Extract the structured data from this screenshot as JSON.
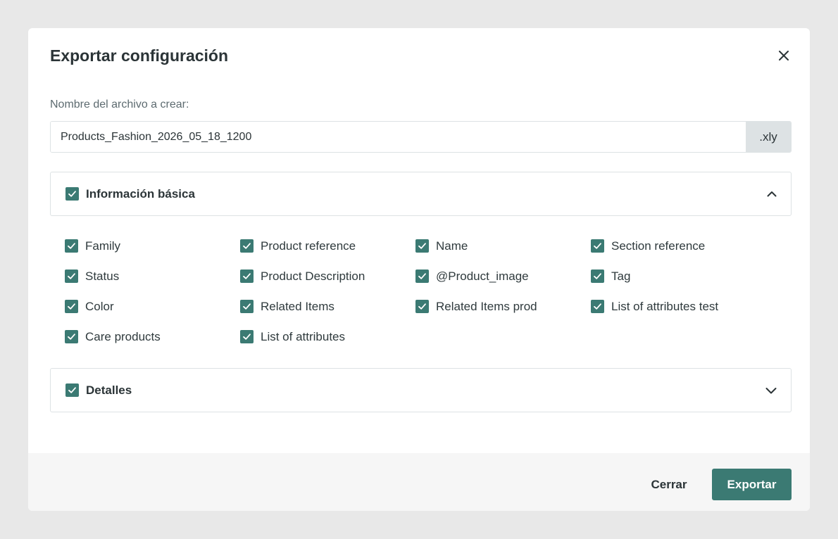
{
  "modal": {
    "title": "Exportar configuración"
  },
  "filename": {
    "label": "Nombre del archivo a crear:",
    "value": "Products_Fashion_2026_05_18_1200",
    "extension": ".xly"
  },
  "sections": [
    {
      "title": "Información básica",
      "checked": true,
      "expanded": true,
      "toggle_icon": "chevron-up-icon",
      "fields": [
        {
          "label": "Family",
          "checked": true
        },
        {
          "label": "Product reference",
          "checked": true
        },
        {
          "label": "Name",
          "checked": true
        },
        {
          "label": "Section reference",
          "checked": true
        },
        {
          "label": "Status",
          "checked": true
        },
        {
          "label": "Product Description",
          "checked": true
        },
        {
          "label": "@Product_image",
          "checked": true
        },
        {
          "label": "Tag",
          "checked": true
        },
        {
          "label": "Color",
          "checked": true
        },
        {
          "label": "Related Items",
          "checked": true
        },
        {
          "label": "Related Items prod",
          "checked": true
        },
        {
          "label": "List of attributes test",
          "checked": true
        },
        {
          "label": "Care products",
          "checked": true
        },
        {
          "label": "List of attributes",
          "checked": true
        }
      ]
    },
    {
      "title": "Detalles",
      "checked": true,
      "expanded": false,
      "toggle_icon": "chevron-down-icon"
    }
  ],
  "footer": {
    "close_label": "Cerrar",
    "export_label": "Exportar"
  },
  "colors": {
    "accent": "#3b7a73",
    "background": "#e8e8e8",
    "footer_bg": "#f6f6f6",
    "border": "#dde2e4"
  }
}
